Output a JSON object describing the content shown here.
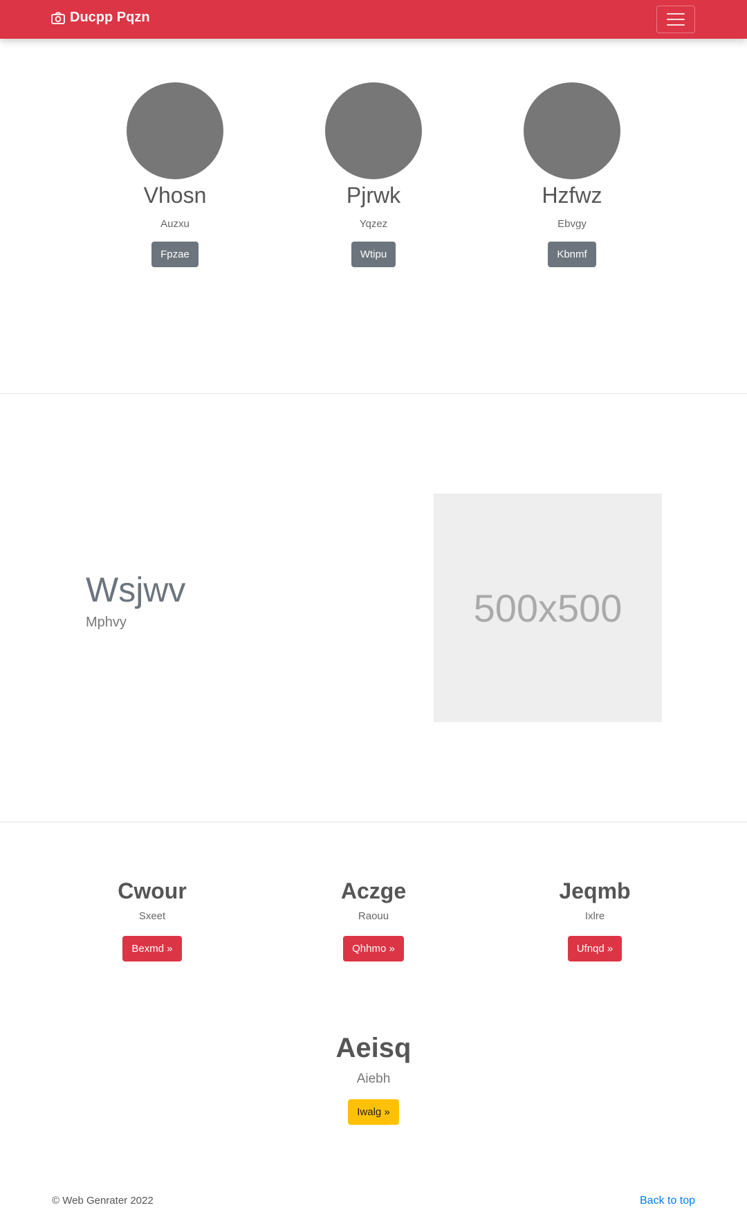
{
  "navbar": {
    "brand": "Ducpp Pqzn",
    "brand_icon": "camera-icon",
    "toggler_icon": "hamburger-icon",
    "bg_color": "#dc3545"
  },
  "team": [
    {
      "name": "Vhosn",
      "role": "Auzxu",
      "button": "Fpzae"
    },
    {
      "name": "Pjrwk",
      "role": "Yqzez",
      "button": "Wtipu"
    },
    {
      "name": "Hzfwz",
      "role": "Ebvgy",
      "button": "Kbnmf"
    }
  ],
  "feature": {
    "heading": "Wsjwv",
    "subheading": "Mphvy",
    "image_placeholder": "500x500"
  },
  "columns": [
    {
      "title": "Cwour",
      "subtitle": "Sxeet",
      "button": "Bexmd »"
    },
    {
      "title": "Aczge",
      "subtitle": "Raouu",
      "button": "Qhhmo »"
    },
    {
      "title": "Jeqmb",
      "subtitle": "Ixlre",
      "button": "Ufnqd »"
    }
  ],
  "highlight": {
    "title": "Aeisq",
    "subtitle": "Aiebh",
    "button": "Iwalg »"
  },
  "footer": {
    "copyright": "© Web Genrater 2022",
    "back_to_top": "Back to top"
  }
}
